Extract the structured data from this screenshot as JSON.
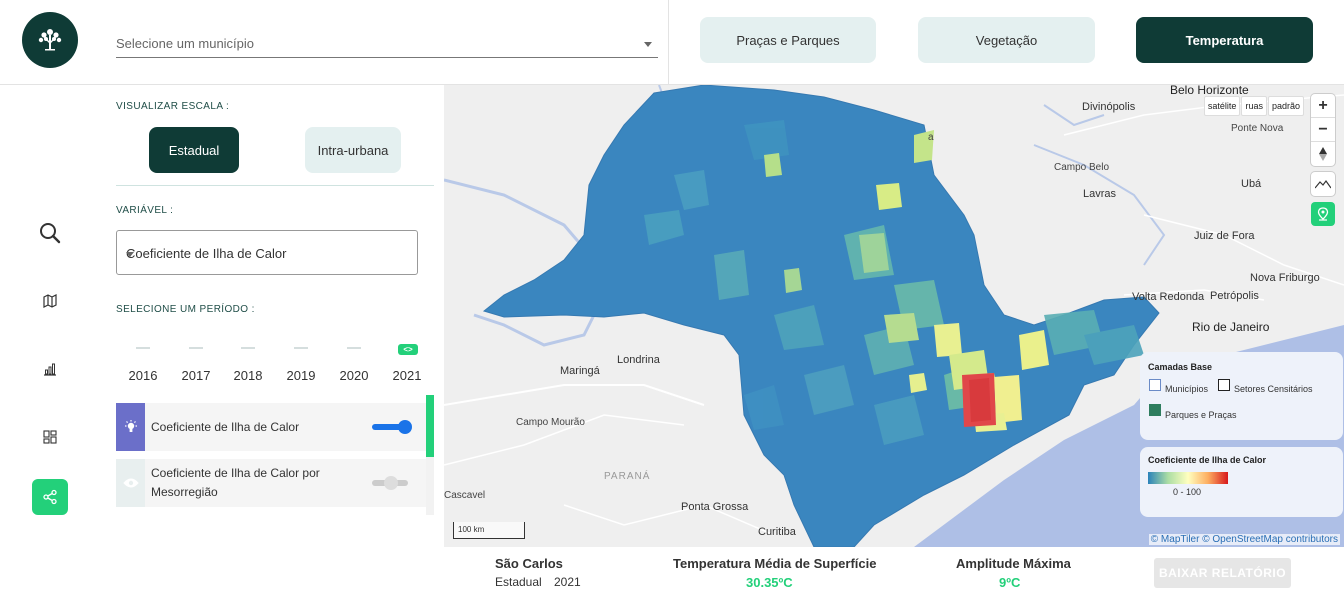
{
  "header": {
    "municipio_placeholder": "Selecione um município",
    "tabs": [
      {
        "label": "Praças e Parques",
        "active": false
      },
      {
        "label": "Vegetação",
        "active": false
      },
      {
        "label": "Temperatura",
        "active": true
      }
    ]
  },
  "sidebar_icons": [
    "search-icon",
    "map-icon",
    "chart-icon",
    "dashboard-icon",
    "share-icon"
  ],
  "panel": {
    "scale_label": "VISUALIZAR ESCALA :",
    "scale_options": [
      {
        "label": "Estadual",
        "active": true
      },
      {
        "label": "Intra-urbana",
        "active": false
      }
    ],
    "variable_label": "VARIÁVEL :",
    "variable_value": "Coeficiente de Ilha de Calor",
    "period_label": "SELECIONE UM PERÍODO :",
    "years": [
      "2016",
      "2017",
      "2018",
      "2019",
      "2020",
      "2021"
    ],
    "selected_year": "2021",
    "selected_marker": "<>",
    "layers": [
      {
        "label": "Coeficiente de Ilha de Calor",
        "enabled": true,
        "icon": "lightbulb-icon"
      },
      {
        "label": "Coeficiente de Ilha de Calor por Mesorregião",
        "enabled": false,
        "icon": "eye-icon"
      }
    ]
  },
  "map": {
    "style_buttons": [
      "satélite",
      "ruas",
      "padrão"
    ],
    "zoom_in": "+",
    "zoom_out": "−",
    "places": {
      "belo_horizonte": "Belo Horizonte",
      "divinopolis": "Divinópolis",
      "ponte_nova": "Ponte Nova",
      "campo_belo": "Campo Belo",
      "uba": "Ubá",
      "lavras": "Lavras",
      "juiz_de_fora": "Juiz de Fora",
      "nova_friburgo": "Nova Friburgo",
      "volta_redonda": "Volta Redonda",
      "petropolis": "Petrópolis",
      "rio_de_janeiro": "Rio de Janeiro",
      "maringa": "Maringá",
      "londrina": "Londrina",
      "campo_mourao": "Campo Mourão",
      "parana": "PARANÁ",
      "cascavel": "Cascavel",
      "ponta_grossa": "Ponta Grossa",
      "curitiba": "Curitiba",
      "franca_partial": "a"
    },
    "scale_label": "100 km",
    "attribution": "© MapTiler © OpenStreetMap contributors",
    "base_layers": {
      "title": "Camadas Base",
      "items": [
        "Municípios",
        "Setores Censitários",
        "Parques e Praças"
      ]
    },
    "legend": {
      "title": "Coeficiente de Ilha de Calor",
      "range": "0 - 100",
      "colors": [
        "#2b83ba",
        "#abdda4",
        "#ffffbf",
        "#fdae61",
        "#d7191c"
      ]
    }
  },
  "footer": {
    "city": "São Carlos",
    "scale": "Estadual",
    "year": "2021",
    "temp_title": "Temperatura Média de Superfície",
    "temp_value": "30.35ºC",
    "amp_title": "Amplitude Máxima",
    "amp_value": "9ºC",
    "download_label": "BAIXAR RELATÓRIO"
  },
  "colors": {
    "brand_dark": "#0f3b36",
    "accent_green": "#23d07a",
    "light_button": "#e4f0f0"
  }
}
